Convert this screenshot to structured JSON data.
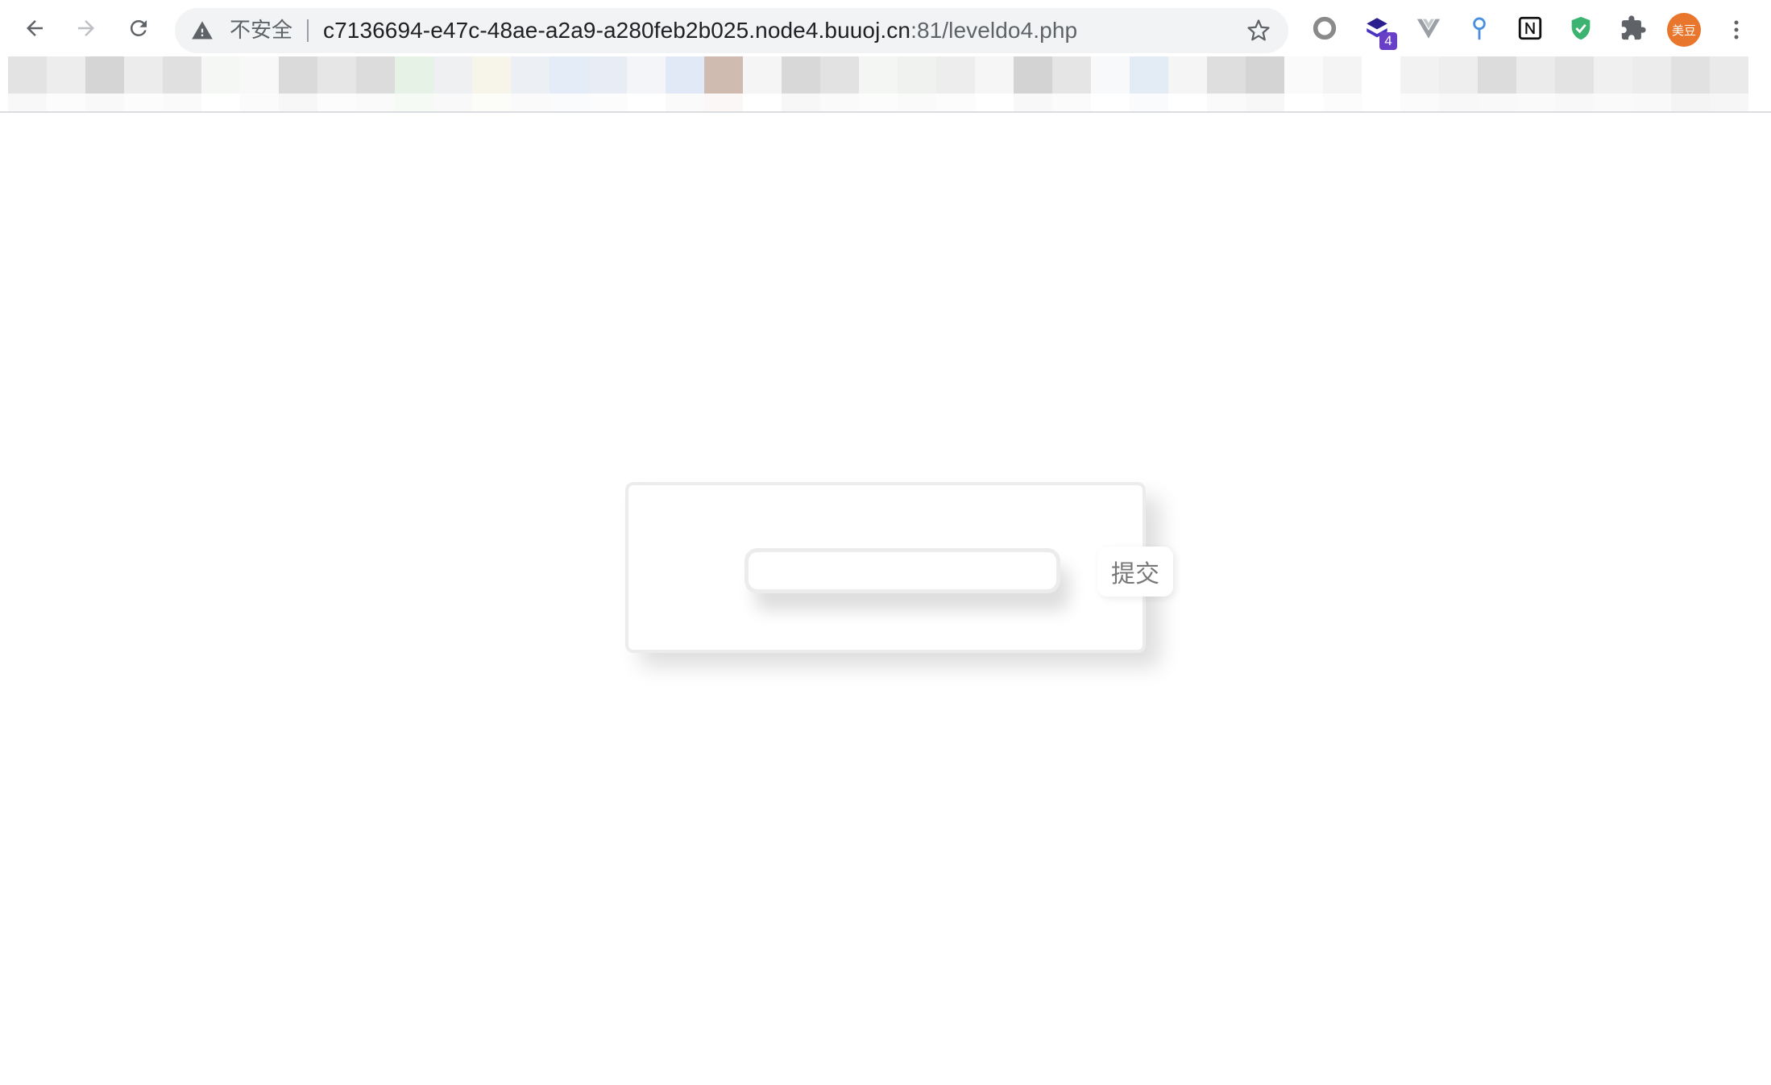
{
  "browser": {
    "security_label": "不安全",
    "url_host": "c7136694-e47c-48ae-a2a9-a280feb2b025.node4.buuoj.cn",
    "url_path": ":81/leveldo4.php",
    "extension_badge": "4",
    "avatar_label": "美豆"
  },
  "form": {
    "input_value": "",
    "input_placeholder": "",
    "submit_label": "提交"
  }
}
